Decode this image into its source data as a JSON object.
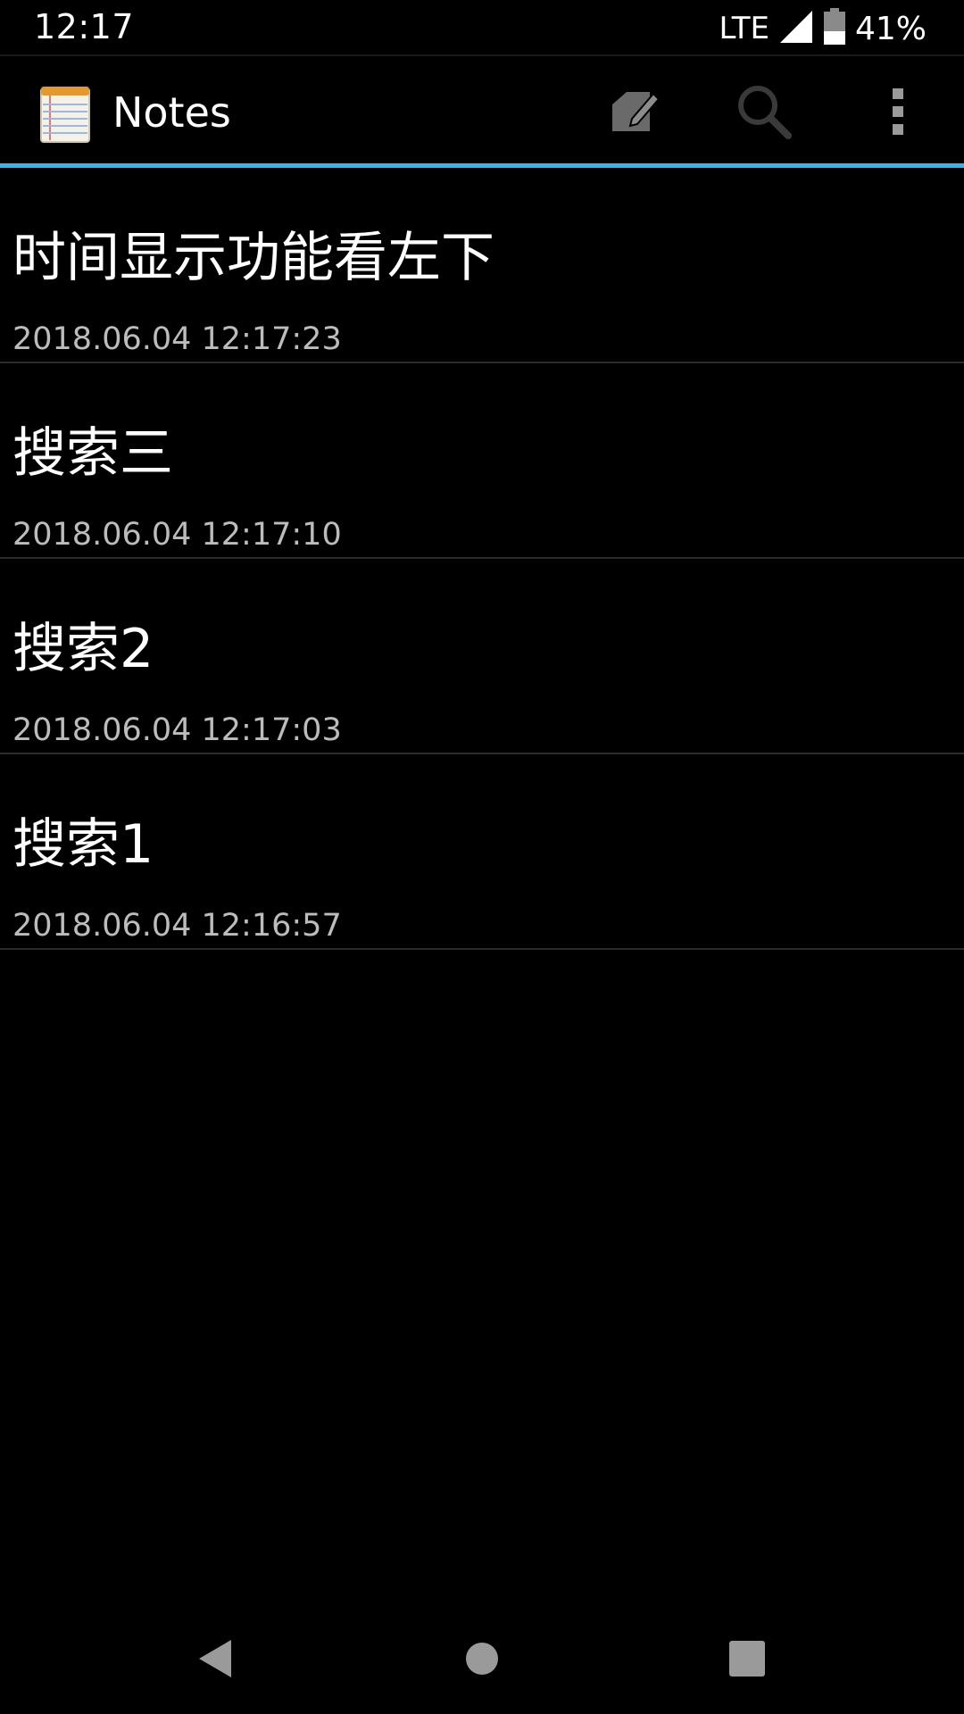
{
  "status_bar": {
    "time": "12:17",
    "network": "LTE",
    "battery_percent": "41%",
    "battery_level": 0.41,
    "signal_icon": "cell-signal-icon",
    "battery_icon": "battery-icon"
  },
  "action_bar": {
    "title": "Notes",
    "app_icon": "notepad-icon",
    "actions": [
      {
        "name": "new-note",
        "icon": "edit-note-icon"
      },
      {
        "name": "search",
        "icon": "search-icon"
      },
      {
        "name": "more",
        "icon": "overflow-menu-icon"
      }
    ],
    "accent_color": "#33b5e5"
  },
  "notes": [
    {
      "title": "时间显示功能看左下",
      "date": "2018.06.04 12:17:23"
    },
    {
      "title": "搜索三",
      "date": "2018.06.04 12:17:10"
    },
    {
      "title": "搜索2",
      "date": "2018.06.04 12:17:03"
    },
    {
      "title": "搜索1",
      "date": "2018.06.04 12:16:57"
    }
  ],
  "nav_bar": {
    "back_icon": "back-icon",
    "home_icon": "home-icon",
    "recents_icon": "recents-icon"
  }
}
